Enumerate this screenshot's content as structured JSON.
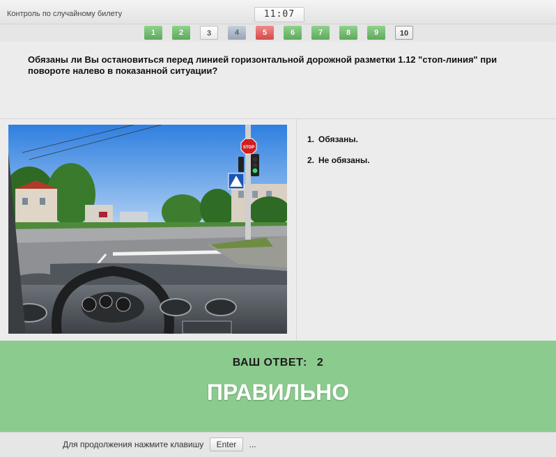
{
  "header": {
    "title": "Контроль по случайному билету",
    "timer": "11:07"
  },
  "questions": [
    {
      "label": "1",
      "status": "correct"
    },
    {
      "label": "2",
      "status": "correct"
    },
    {
      "label": "3",
      "status": "neutral"
    },
    {
      "label": "4",
      "status": "blue"
    },
    {
      "label": "5",
      "status": "wrong"
    },
    {
      "label": "6",
      "status": "correct"
    },
    {
      "label": "7",
      "status": "correct"
    },
    {
      "label": "8",
      "status": "correct"
    },
    {
      "label": "9",
      "status": "correct"
    },
    {
      "label": "10",
      "status": "current"
    }
  ],
  "question": {
    "text": "Обязаны ли Вы остановиться перед линией горизонтальной дорожной разметки 1.12 \"стоп-линия\" при повороте налево в показанной ситуации?"
  },
  "scene": {
    "stop_sign_text": "STOP"
  },
  "answers": [
    {
      "number": "1.",
      "text": "Обязаны."
    },
    {
      "number": "2.",
      "text": "Не обязаны."
    }
  ],
  "result": {
    "label": "ВАШ ОТВЕТ:",
    "value": "2",
    "verdict": "ПРАВИЛЬНО"
  },
  "footer": {
    "before": "Для продолжения нажмите клавишу",
    "key": "Enter",
    "after": "..."
  },
  "colors": {
    "correct": "#6bb868",
    "wrong": "#e25c5c",
    "result_bg": "#8ccb8e"
  }
}
